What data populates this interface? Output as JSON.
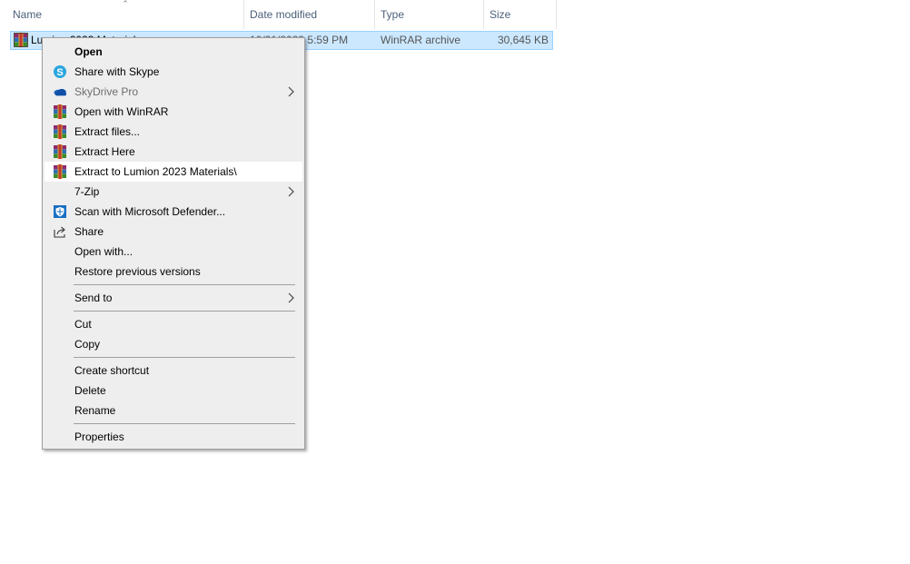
{
  "columns": {
    "name": "Name",
    "date_modified": "Date modified",
    "type": "Type",
    "size": "Size"
  },
  "file": {
    "name": "Lumion 2023 Materials",
    "date_modified": "10/21/2023 5:59 PM",
    "type": "WinRAR archive",
    "size": "30,645 KB",
    "icon": "winrar-archive-icon"
  },
  "context_menu": {
    "items": [
      {
        "label": "Open"
      },
      {
        "label": "Share with Skype",
        "icon": "skype-icon"
      },
      {
        "label": "SkyDrive Pro",
        "icon": "onedrive-icon"
      },
      {
        "label": "Open with WinRAR",
        "icon": "winrar-icon"
      },
      {
        "label": "Extract files...",
        "icon": "winrar-icon"
      },
      {
        "label": "Extract Here",
        "icon": "winrar-icon"
      },
      {
        "label": "Extract to Lumion 2023 Materials\\",
        "icon": "winrar-icon"
      },
      {
        "label": "7-Zip"
      },
      {
        "label": "Scan with Microsoft Defender...",
        "icon": "defender-icon"
      },
      {
        "label": "Share",
        "icon": "share-icon"
      },
      {
        "label": "Open with..."
      },
      {
        "label": "Restore previous versions"
      },
      {
        "label": "Send to"
      },
      {
        "label": "Cut"
      },
      {
        "label": "Copy"
      },
      {
        "label": "Create shortcut"
      },
      {
        "label": "Delete"
      },
      {
        "label": "Rename"
      },
      {
        "label": "Properties"
      }
    ]
  }
}
